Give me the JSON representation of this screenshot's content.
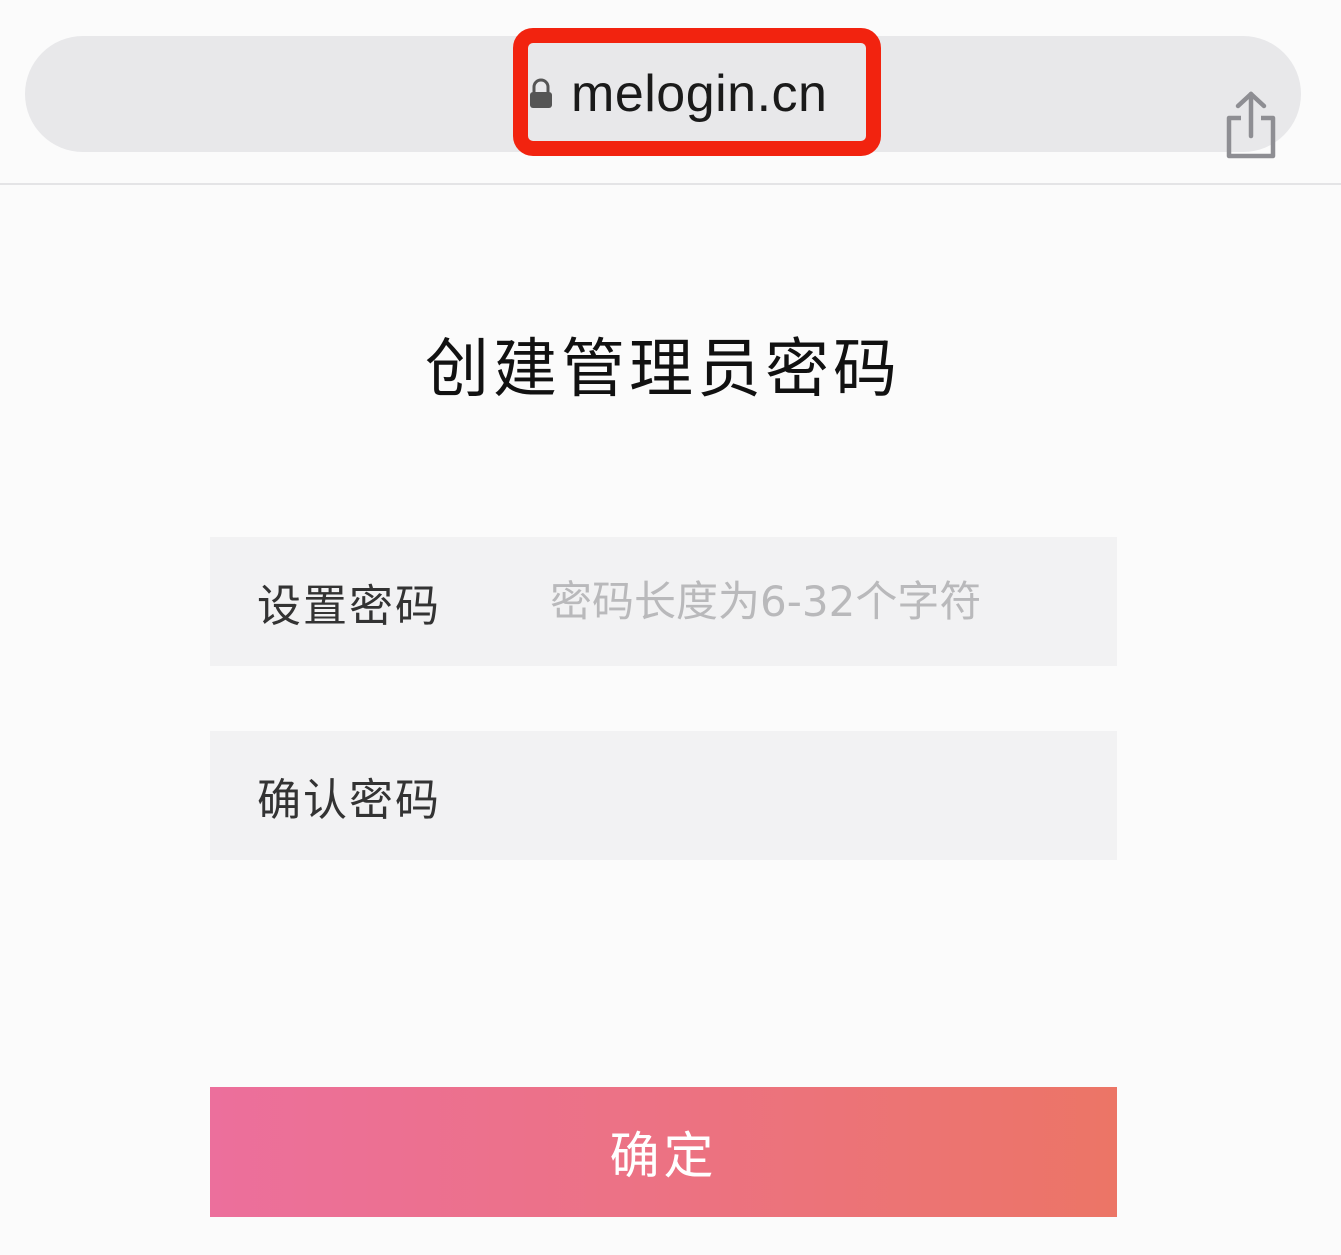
{
  "browser": {
    "url": "melogin.cn"
  },
  "page": {
    "title": "创建管理员密码"
  },
  "form": {
    "password": {
      "label": "设置密码",
      "placeholder": "密码长度为6-32个字符",
      "value": ""
    },
    "confirm": {
      "label": "确认密码",
      "placeholder": "",
      "value": ""
    },
    "submit_label": "确定"
  },
  "colors": {
    "highlight": "#f2230f",
    "button_gradient_start": "#ec6f9c",
    "button_gradient_end": "#ec7566"
  },
  "icons": {
    "lock": "lock-icon",
    "share": "share-icon"
  }
}
